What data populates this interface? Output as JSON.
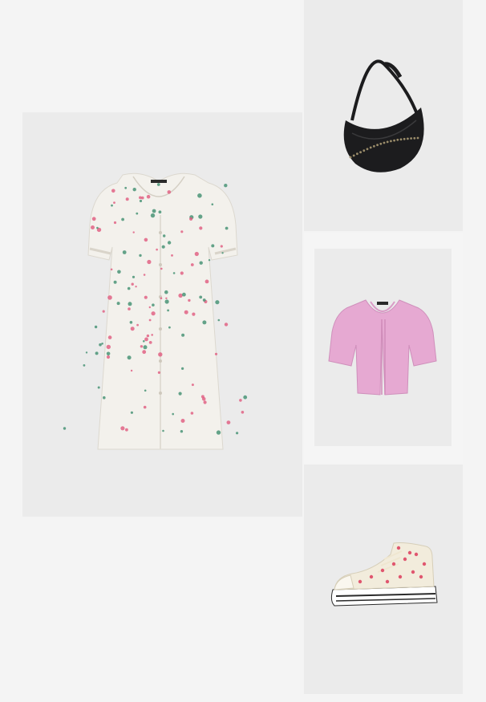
{
  "outfit": {
    "items": [
      {
        "key": "dress",
        "icon": "floral-dress-icon"
      },
      {
        "key": "bag",
        "icon": "studded-shoulder-bag-icon"
      },
      {
        "key": "cardigan",
        "icon": "pink-cardigan-icon"
      },
      {
        "key": "sneaker",
        "icon": "floral-high-top-sneaker-icon"
      }
    ]
  },
  "colors": {
    "page_background": "#f4f4f4",
    "tile_background": "#ebebeb",
    "dress_base": "#f3f1ec",
    "dress_flower_pink": "#e05a7e",
    "dress_flower_green": "#3f8f6f",
    "bag": "#1c1c1e",
    "cardigan": "#e6a9d2",
    "sneaker_canvas": "#f2ecdc",
    "sneaker_flower": "#e0566f"
  }
}
